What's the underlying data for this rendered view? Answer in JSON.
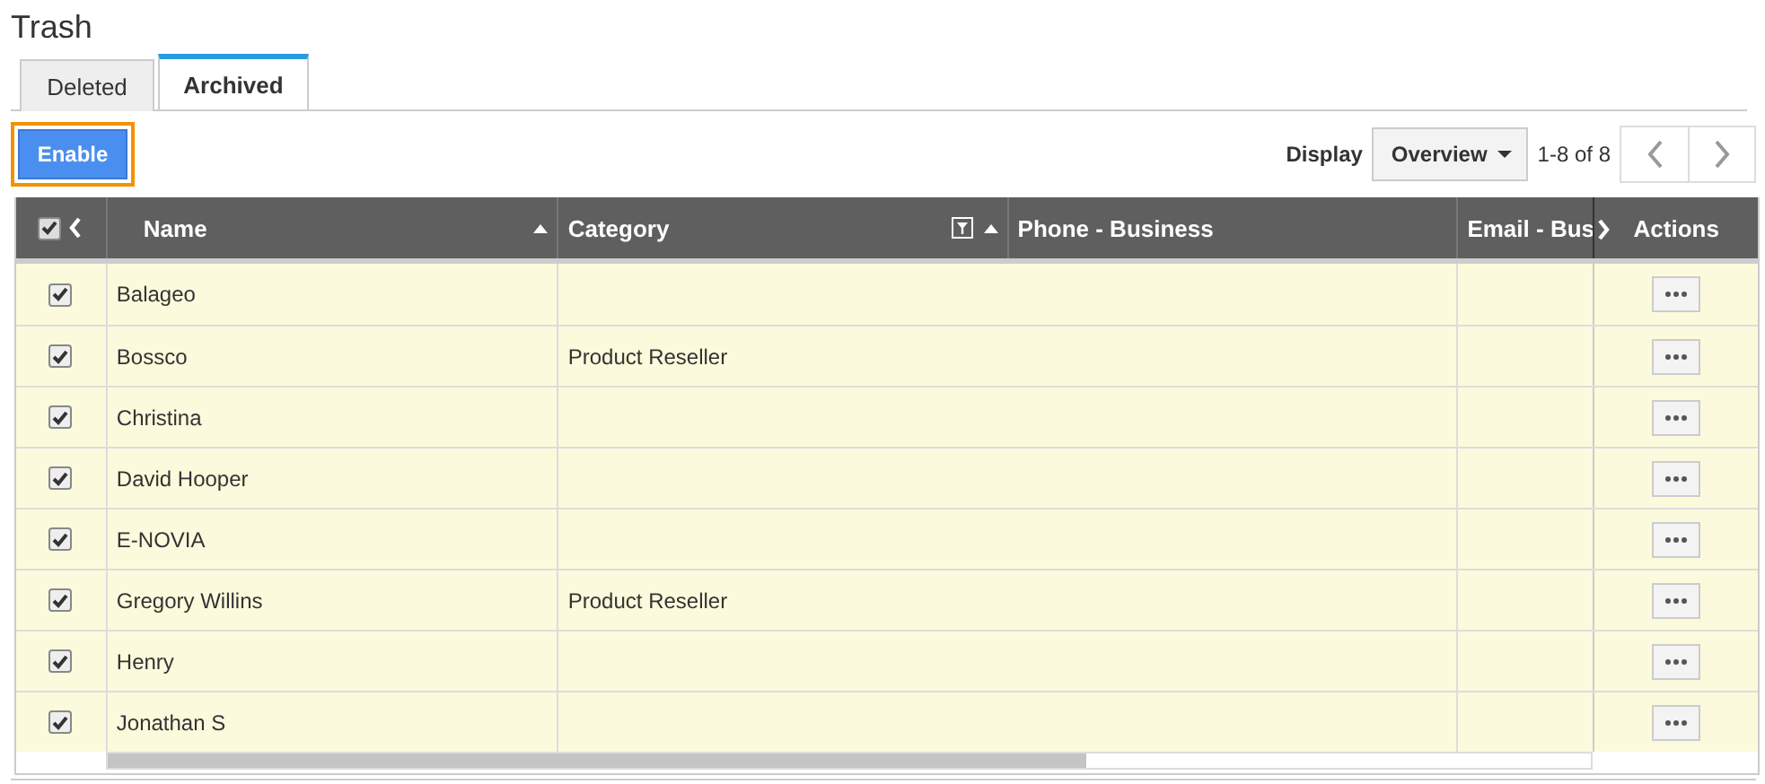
{
  "page_title": "Trash",
  "tabs": [
    {
      "label": "Deleted",
      "selected": false
    },
    {
      "label": "Archived",
      "selected": true
    }
  ],
  "enable_button": {
    "label": "Enable",
    "focused": true
  },
  "display": {
    "label": "Display",
    "value": "Overview",
    "range": "1-8 of 8"
  },
  "table": {
    "select_all_checked": true,
    "columns": [
      {
        "label": "Name",
        "sortable": true,
        "filter": false
      },
      {
        "label": "Category",
        "sortable": true,
        "filter": true
      },
      {
        "label": "Phone - Business",
        "sortable": false,
        "filter": false
      },
      {
        "label": "Email - Bus"
      },
      {
        "label": "Actions",
        "sortable": false,
        "filter": false
      }
    ],
    "rows": [
      {
        "checked": true,
        "name": "Balageo",
        "category": ""
      },
      {
        "checked": true,
        "name": "Bossco",
        "category": "Product Reseller"
      },
      {
        "checked": true,
        "name": "Christina",
        "category": ""
      },
      {
        "checked": true,
        "name": "David Hooper",
        "category": ""
      },
      {
        "checked": true,
        "name": "E-NOVIA",
        "category": ""
      },
      {
        "checked": true,
        "name": "Gregory Willins",
        "category": "Product Reseller"
      },
      {
        "checked": true,
        "name": "Henry",
        "category": ""
      },
      {
        "checked": true,
        "name": "Jonathan S",
        "category": ""
      }
    ]
  }
}
